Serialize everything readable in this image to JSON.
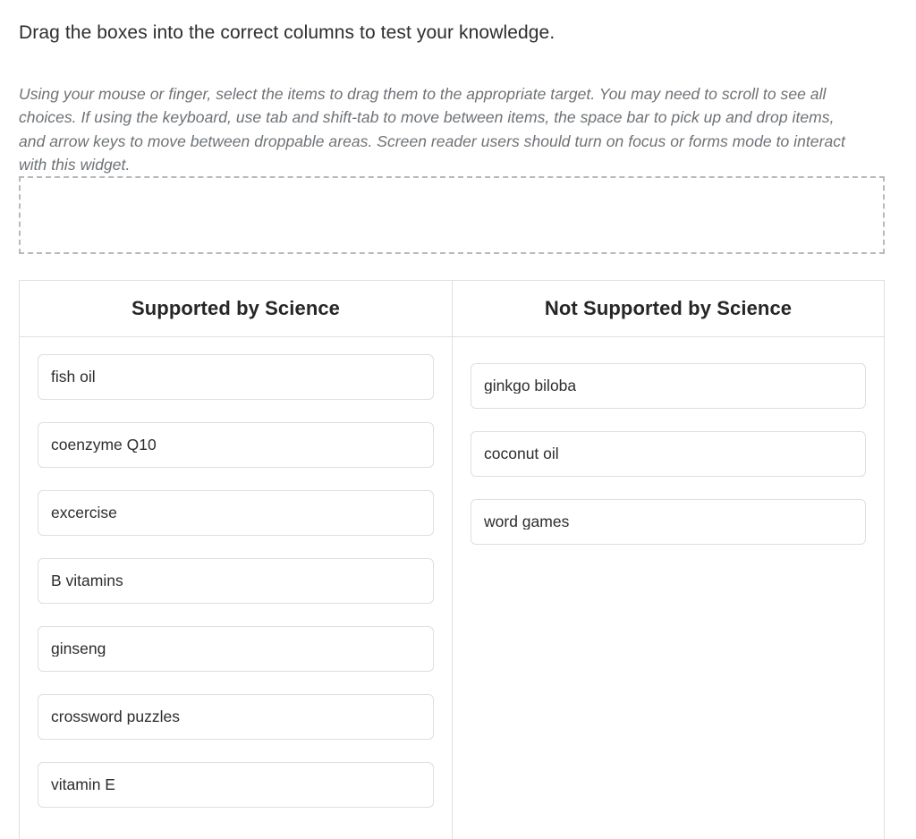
{
  "prompt": {
    "heading": "Drag the boxes into the correct columns to test your knowledge.",
    "instructions": "Using your mouse or finger, select the items to drag them to the appropriate target. You may need to scroll to see all choices. If using the keyboard, use tab and shift-tab to move between items, the space bar to pick up and drop items, and arrow keys to move between droppable areas. Screen reader users should turn on focus or forms mode to interact with this widget."
  },
  "source_zone": {
    "items": []
  },
  "columns": [
    {
      "header": "Supported by Science",
      "items": [
        "fish oil",
        "coenzyme Q10",
        "excercise",
        "B vitamins",
        "ginseng",
        "crossword puzzles",
        "vitamin E"
      ]
    },
    {
      "header": "Not Supported by Science",
      "items": [
        "ginkgo biloba",
        "coconut oil",
        "word games"
      ]
    }
  ],
  "colors": {
    "page_background": "#ffffff",
    "heading_text": "#2e2e2e",
    "instruction_text": "#6e7276",
    "dashed_border": "#b9b9b9",
    "table_border": "#e0e0e0",
    "item_border": "#dfdfdf",
    "item_text": "#2d2d2d"
  }
}
